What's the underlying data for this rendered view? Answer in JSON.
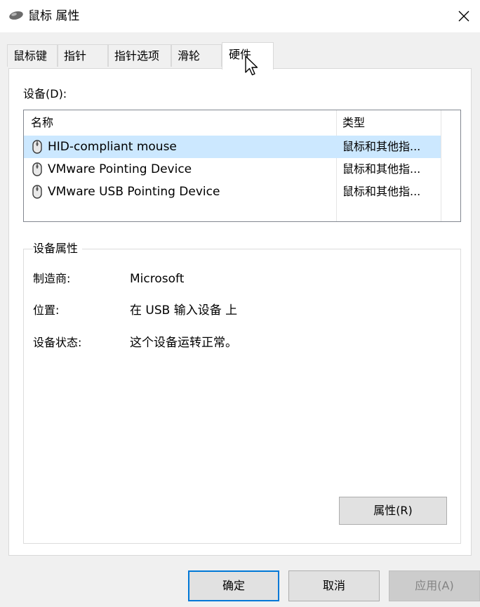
{
  "window": {
    "title": "鼠标 属性",
    "title_icon": "mouse-icon",
    "close_icon": "close-icon"
  },
  "tabs": [
    {
      "label": "鼠标键",
      "active": false
    },
    {
      "label": "指针",
      "active": false
    },
    {
      "label": "指针选项",
      "active": false
    },
    {
      "label": "滑轮",
      "active": false
    },
    {
      "label": "硬件",
      "active": true
    }
  ],
  "devices": {
    "label": "设备(D):",
    "columns": {
      "name": "名称",
      "type": "类型"
    },
    "rows": [
      {
        "name": "HID-compliant mouse",
        "type": "鼠标和其他指...",
        "selected": true,
        "icon": "mouse-icon"
      },
      {
        "name": "VMware Pointing Device",
        "type": "鼠标和其他指...",
        "selected": false,
        "icon": "mouse-icon"
      },
      {
        "name": "VMware USB Pointing Device",
        "type": "鼠标和其他指...",
        "selected": false,
        "icon": "mouse-icon"
      }
    ]
  },
  "device_properties": {
    "title": "设备属性",
    "manufacturer_label": "制造商:",
    "manufacturer_value": "Microsoft",
    "location_label": "位置:",
    "location_value": "在 USB 输入设备 上",
    "status_label": "设备状态:",
    "status_value": "这个设备运转正常。",
    "properties_button": "属性(R)"
  },
  "footer": {
    "ok": "确定",
    "cancel": "取消",
    "apply": "应用(A)"
  },
  "colors": {
    "selection": "#cce8ff",
    "focus_border": "#0078d7"
  }
}
